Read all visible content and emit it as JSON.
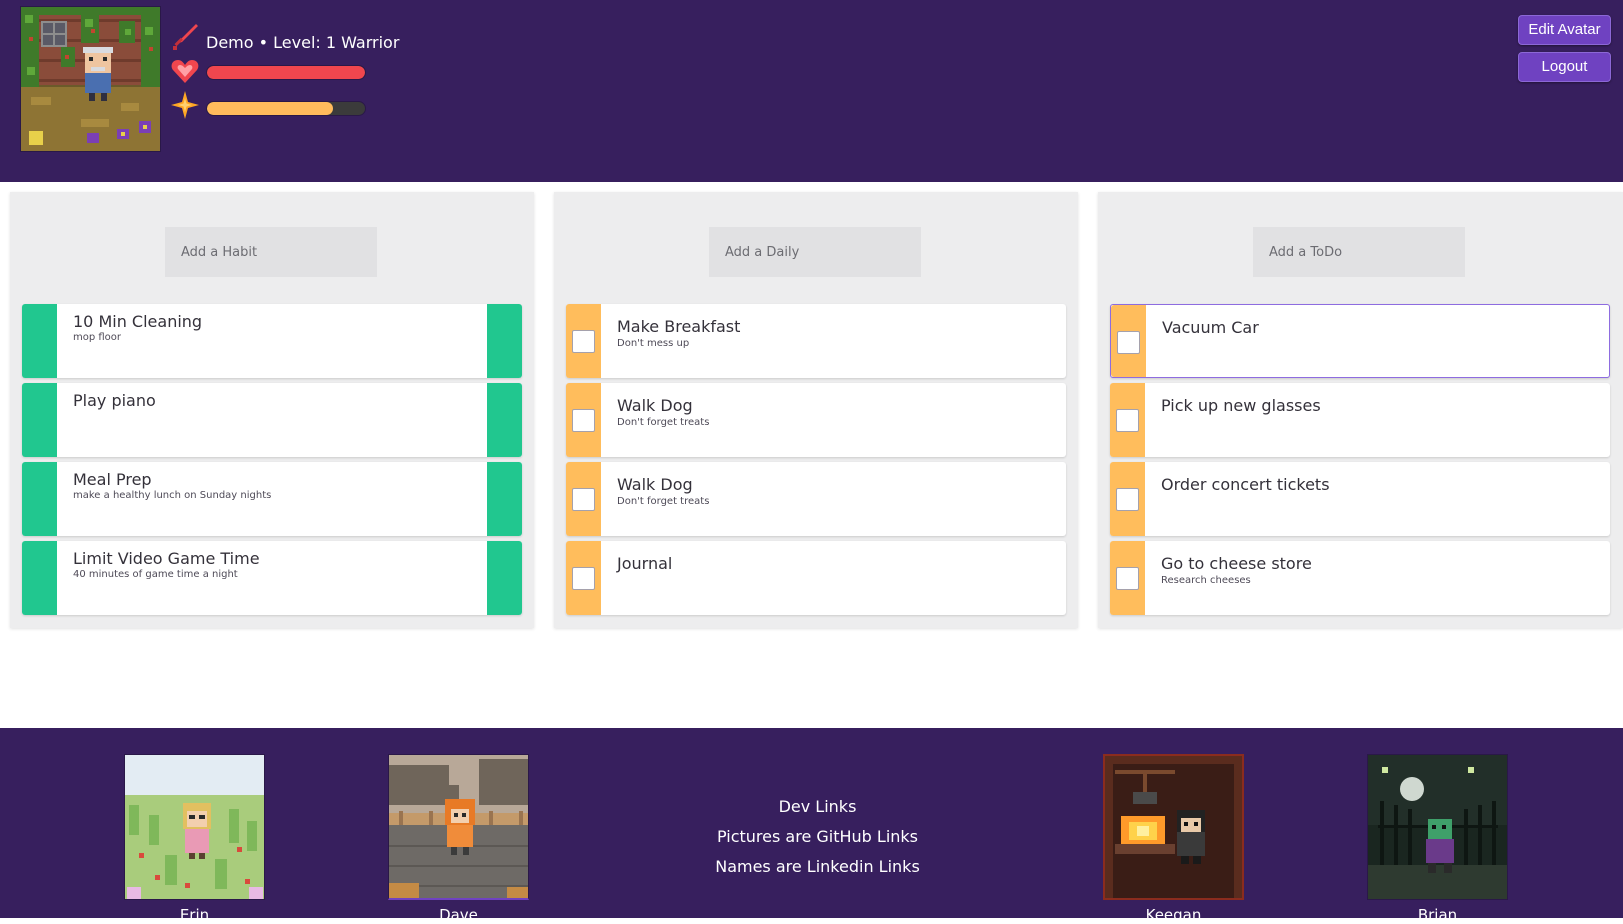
{
  "header": {
    "player_line": "Demo • Level: 1 Warrior",
    "health": 1.0,
    "experience": 0.8,
    "edit_avatar_label": "Edit Avatar",
    "logout_label": "Logout",
    "icons": [
      "sword-icon",
      "heart-icon",
      "star-icon"
    ]
  },
  "colors": {
    "header_bg": "#371f5e",
    "habit_green": "#21c78f",
    "daily_orange": "#ffbd5c",
    "todo_orange": "#ffbd5c",
    "health_red": "#f0464e",
    "xp_gold": "#ffbb5c",
    "button_purple": "#6f42c1"
  },
  "habits": {
    "placeholder": "Add a Habit",
    "items": [
      {
        "title": "10 Min Cleaning",
        "notes": "mop floor"
      },
      {
        "title": "Play piano",
        "notes": ""
      },
      {
        "title": "Meal Prep",
        "notes": "make a healthy lunch on Sunday nights"
      },
      {
        "title": "Limit Video Game Time",
        "notes": "40 minutes of game time a night"
      }
    ]
  },
  "dailies": {
    "placeholder": "Add a Daily",
    "items": [
      {
        "title": "Make Breakfast",
        "notes": "Don't mess up"
      },
      {
        "title": "Walk Dog",
        "notes": "Don't forget treats"
      },
      {
        "title": "Walk Dog",
        "notes": "Don't forget treats"
      },
      {
        "title": "Journal",
        "notes": ""
      }
    ]
  },
  "todos": {
    "placeholder": "Add a ToDo",
    "items": [
      {
        "title": "Vacuum Car",
        "notes": ""
      },
      {
        "title": "Pick up new glasses",
        "notes": ""
      },
      {
        "title": "Order concert tickets",
        "notes": ""
      },
      {
        "title": "Go to cheese store",
        "notes": "Research cheeses"
      }
    ]
  },
  "footer": {
    "dev_links_title": "Dev Links",
    "dev_links_line1": "Pictures are GitHub Links",
    "dev_links_line2": "Names are Linkedin Links",
    "devs": [
      {
        "name": "Erin"
      },
      {
        "name": "Dave"
      },
      {
        "name": "Keegan"
      },
      {
        "name": "Brian"
      }
    ]
  }
}
